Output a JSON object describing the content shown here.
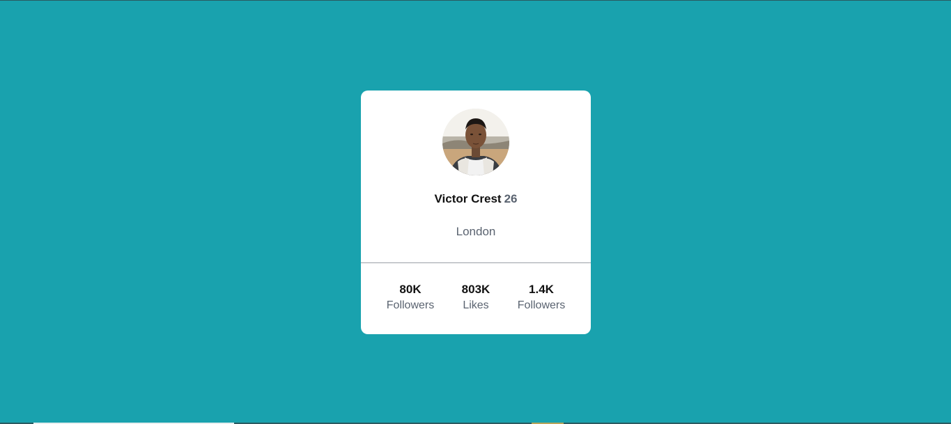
{
  "colors": {
    "background": "#19a2ae",
    "card": "#ffffff",
    "text_primary": "#111111",
    "text_secondary": "#5a6370"
  },
  "profile": {
    "avatar_icon": "profile-photo",
    "name": "Victor Crest",
    "age": "26",
    "city": "London"
  },
  "stats": [
    {
      "value": "80K",
      "label": "Followers"
    },
    {
      "value": "803K",
      "label": "Likes"
    },
    {
      "value": "1.4K",
      "label": "Followers"
    }
  ]
}
